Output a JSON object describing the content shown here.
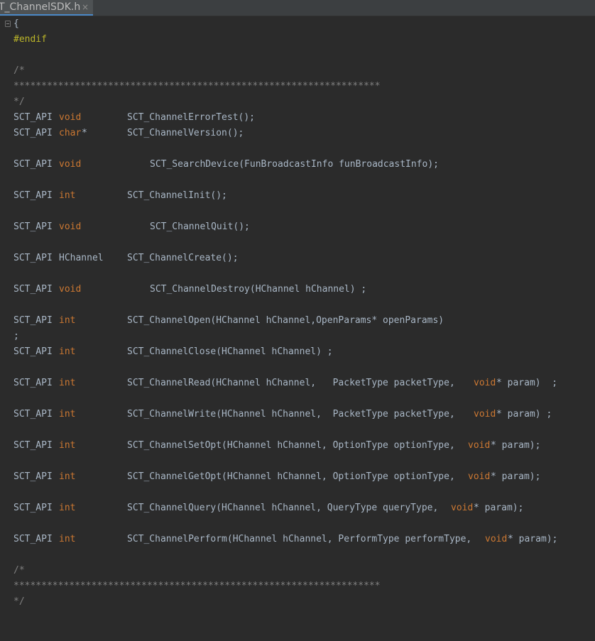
{
  "tab": {
    "label": "T_ChannelSDK.h",
    "close_glyph": "×"
  },
  "code": {
    "l01": "{",
    "l02": "#endif",
    "l04": "/*",
    "l05": "******************************************************************",
    "l06": "*/",
    "l07": {
      "a": "SCT_API",
      "t": "void",
      "f": "SCT_ChannelErrorTest();"
    },
    "l08": {
      "a": "SCT_API",
      "t": "char",
      "s": "*",
      "f": "SCT_ChannelVersion();"
    },
    "l10": {
      "a": "SCT_API",
      "t": "void",
      "f": "SCT_SearchDevice(FunBroadcastInfo funBroadcastInfo);"
    },
    "l12": {
      "a": "SCT_API",
      "t": "int",
      "f": "SCT_ChannelInit();"
    },
    "l14": {
      "a": "SCT_API",
      "t": "void",
      "f": "SCT_ChannelQuit();"
    },
    "l16": {
      "a": "SCT_API",
      "t": "HChannel",
      "f": "SCT_ChannelCreate();"
    },
    "l18": {
      "a": "SCT_API",
      "t": "void",
      "f": "SCT_ChannelDestroy(HChannel hChannel) ;"
    },
    "l20": {
      "a": "SCT_API",
      "t": "int",
      "f": "SCT_ChannelOpen(HChannel hChannel,OpenParams* openParams)"
    },
    "l21": ";",
    "l22": {
      "a": "SCT_API",
      "t": "int",
      "f": "SCT_ChannelClose(HChannel hChannel) ;"
    },
    "l24": {
      "a": "SCT_API",
      "t": "int",
      "f1": "SCT_ChannelRead(HChannel hChannel,   PacketType packetType,  ",
      "v": "void",
      "f2": "* param)  ;"
    },
    "l26": {
      "a": "SCT_API",
      "t": "int",
      "f1": "SCT_ChannelWrite(HChannel hChannel,  PacketType packetType,  ",
      "v": "void",
      "f2": "* param) ;"
    },
    "l28": {
      "a": "SCT_API",
      "t": "int",
      "f1": "SCT_ChannelSetOpt(HChannel hChannel, OptionType optionType, ",
      "v": "void",
      "f2": "* param);"
    },
    "l30": {
      "a": "SCT_API",
      "t": "int",
      "f1": "SCT_ChannelGetOpt(HChannel hChannel, OptionType optionType, ",
      "v": "void",
      "f2": "* param);"
    },
    "l32": {
      "a": "SCT_API",
      "t": "int",
      "f1": "SCT_ChannelQuery(HChannel hChannel, QueryType queryType, ",
      "v": "void",
      "f2": "* param);"
    },
    "l34": {
      "a": "SCT_API",
      "t": "int",
      "f1": "SCT_ChannelPerform(HChannel hChannel, PerformType performType, ",
      "v": "void",
      "f2": "* param);"
    },
    "l36": "/*",
    "l37": "******************************************************************",
    "l38": "*/"
  }
}
